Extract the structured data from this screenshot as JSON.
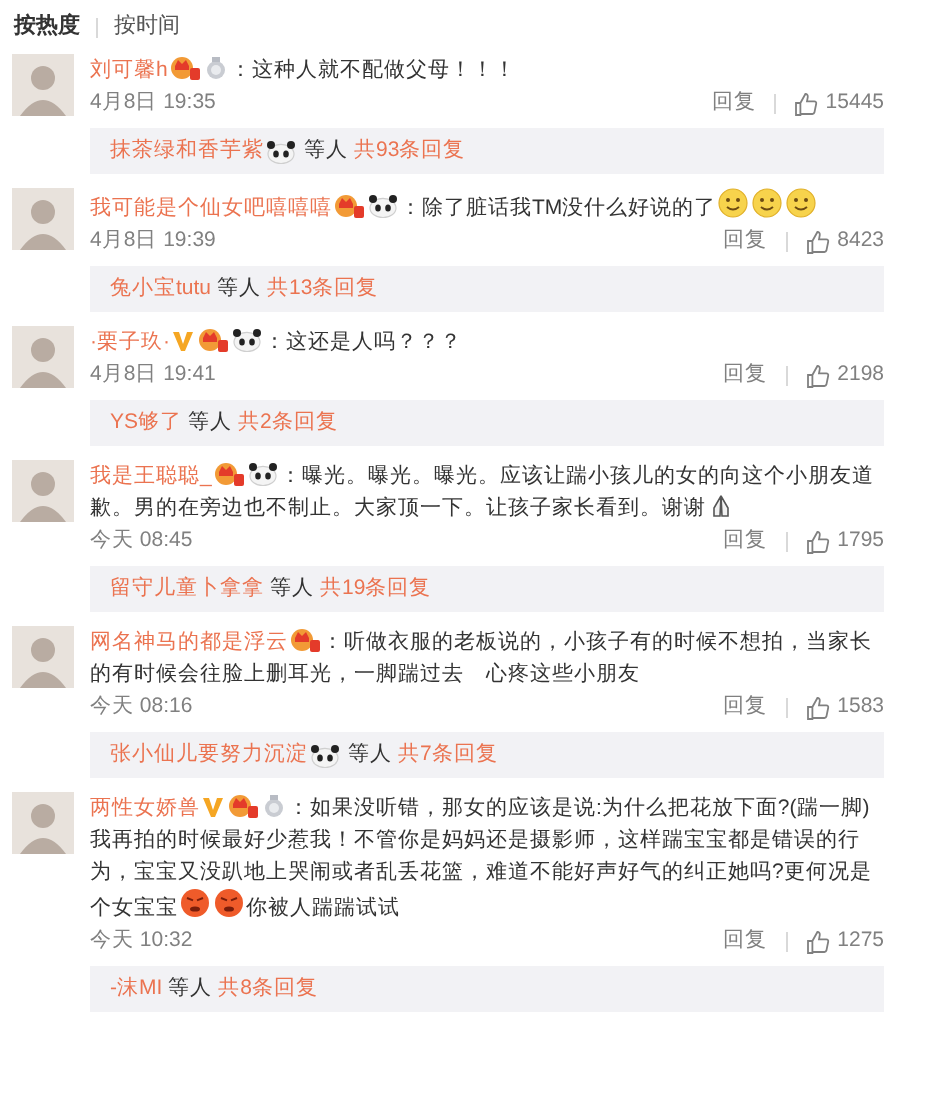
{
  "sort_tabs": [
    {
      "label": "按热度",
      "selected": true
    },
    {
      "label": "按时间",
      "selected": false
    }
  ],
  "comments": [
    {
      "user": "刘可馨h",
      "badges": [
        {
          "kind": "crown"
        },
        {
          "kind": "medal"
        }
      ],
      "segments": [
        {
          "kind": "text",
          "text": "：这种人就不配做父母！！！"
        }
      ],
      "time": "4月8日 19:35",
      "reply_label": "回复",
      "likes": "15445",
      "replies": {
        "user": "抹茶绿和香芋紫",
        "badges": [
          {
            "kind": "panda"
          }
        ],
        "suffix": "等人",
        "count": "共93条回复"
      }
    },
    {
      "user": "我可能是个仙女吧嘻嘻嘻",
      "badges": [
        {
          "kind": "crown"
        },
        {
          "kind": "panda"
        }
      ],
      "segments": [
        {
          "kind": "text",
          "text": "：除了脏话我TM没什么好说的了"
        },
        {
          "kind": "smile"
        },
        {
          "kind": "smile"
        },
        {
          "kind": "smile"
        }
      ],
      "time": "4月8日 19:39",
      "reply_label": "回复",
      "likes": "8423",
      "replies": {
        "user": "兔小宝tutu",
        "suffix": "等人",
        "count": "共13条回复"
      }
    },
    {
      "user": "·栗子玖·",
      "badges": [
        {
          "kind": "v"
        },
        {
          "kind": "crown"
        },
        {
          "kind": "panda"
        }
      ],
      "segments": [
        {
          "kind": "text",
          "text": "：这还是人吗？？？"
        }
      ],
      "time": "4月8日 19:41",
      "reply_label": "回复",
      "likes": "2198",
      "replies": {
        "user": "YS够了",
        "suffix": "等人",
        "count": "共2条回复"
      }
    },
    {
      "user": "我是王聪聪_",
      "badges": [
        {
          "kind": "crown"
        },
        {
          "kind": "panda"
        }
      ],
      "segments": [
        {
          "kind": "text",
          "text": "：曝光。曝光。曝光。应该让踹小孩儿的女的向这个小朋友道歉。男的在旁边也不制止。大家顶一下。让孩子家长看到。谢谢"
        },
        {
          "kind": "hands"
        }
      ],
      "time": "今天 08:45",
      "reply_label": "回复",
      "likes": "1795",
      "replies": {
        "user": "留守儿童卜拿拿",
        "suffix": "等人",
        "count": "共19条回复"
      }
    },
    {
      "user": "网名神马的都是浮云",
      "badges": [
        {
          "kind": "crown"
        }
      ],
      "segments": [
        {
          "kind": "text",
          "text": "：听做衣服的老板说的，小孩子有的时候不想拍，当家长的有时候会往脸上删耳光，一脚踹过去　心疼这些小朋友"
        }
      ],
      "time": "今天 08:16",
      "reply_label": "回复",
      "likes": "1583",
      "replies": {
        "user": "张小仙儿要努力沉淀",
        "badges": [
          {
            "kind": "panda"
          }
        ],
        "suffix": "等人",
        "count": "共7条回复"
      }
    },
    {
      "user": "两性女娇兽",
      "badges": [
        {
          "kind": "v"
        },
        {
          "kind": "crown"
        },
        {
          "kind": "medal"
        }
      ],
      "segments": [
        {
          "kind": "text",
          "text": "：如果没听错，那女的应该是说:为什么把花放下面?(踹一脚)我再拍的时候最好少惹我！不管你是妈妈还是摄影师，这样踹宝宝都是错误的行为，宝宝又没趴地上哭闹或者乱丢花篮，难道不能好声好气的纠正她吗?更何况是个女宝宝"
        },
        {
          "kind": "angry"
        },
        {
          "kind": "angry"
        },
        {
          "kind": "text",
          "text": "你被人踹踹试试"
        }
      ],
      "time": "今天 10:32",
      "reply_label": "回复",
      "likes": "1275",
      "replies": {
        "user": "-沫MI",
        "suffix": "等人",
        "count": "共8条回复"
      }
    }
  ]
}
